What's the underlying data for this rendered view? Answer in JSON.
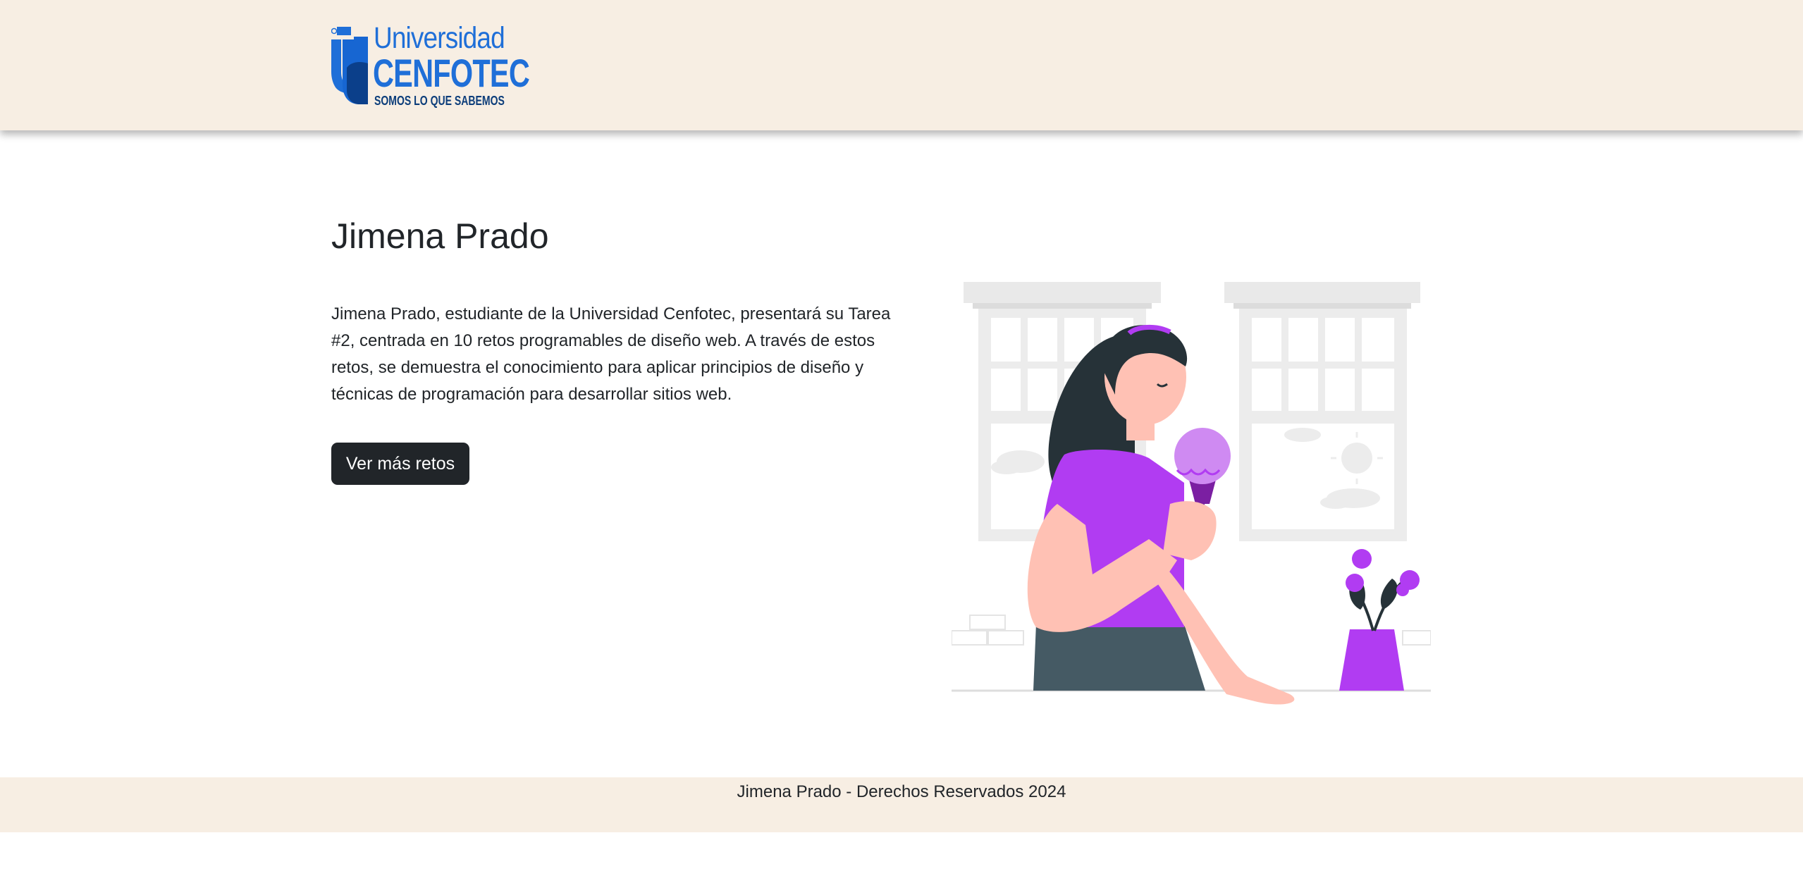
{
  "header": {
    "logo": {
      "word": "Universidad",
      "brand": "CENFOTEC",
      "tagline": "SOMOS LO QUE SABEMOS",
      "icon": "cenfotec-logo-mark"
    }
  },
  "main": {
    "title": "Jimena Prado",
    "description": "Jimena Prado, estudiante de la Universidad Cenfotec, presentará su Tarea #2, centrada en 10 retos programables de diseño web. A través de estos retos, se demuestra el conocimiento para aplicar principios de diseño y técnicas de programación para desarrollar sitios web.",
    "button_label": "Ver más retos",
    "illustration": "girl-eating-ice-cream-illustration"
  },
  "footer": {
    "text": "Jimena Prado - Derechos Reservados 2024"
  },
  "colors": {
    "header_bg": "#f7eee3",
    "footer_bg": "#f7eee3",
    "brand_blue": "#1f6fd8",
    "button_bg": "#212529",
    "accent_purple": "#b13cf2"
  }
}
